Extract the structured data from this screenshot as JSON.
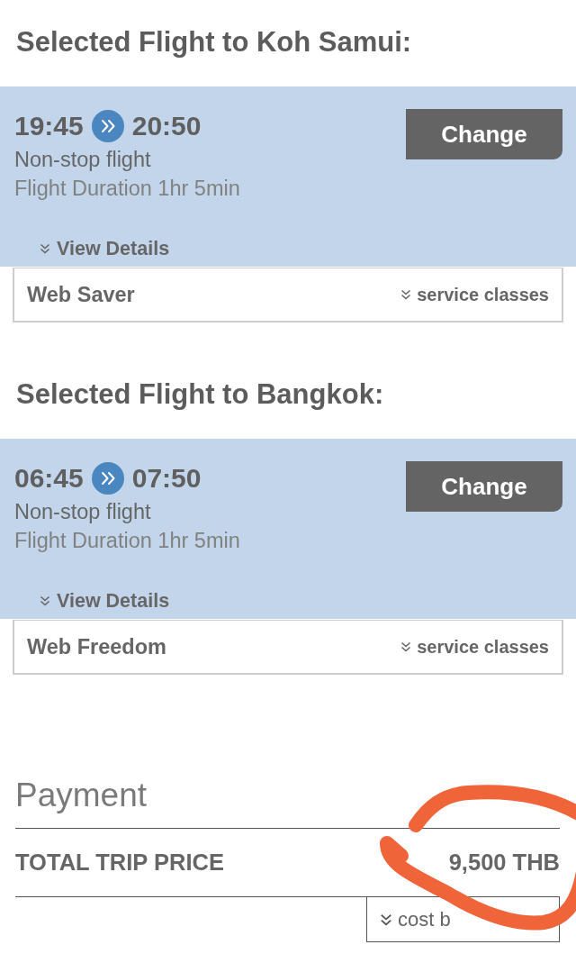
{
  "flights": [
    {
      "heading": "Selected Flight to Koh Samui:",
      "departure": "19:45",
      "arrival": "20:50",
      "stops": "Non-stop flight",
      "duration": "Flight Duration 1hr 5min",
      "change_button": "Change",
      "details_link": "View Details",
      "fare": "Web Saver",
      "service_classes_link": "service classes"
    },
    {
      "heading": "Selected Flight to Bangkok:",
      "departure": "06:45",
      "arrival": "07:50",
      "stops": "Non-stop flight",
      "duration": "Flight Duration 1hr 5min",
      "change_button": "Change",
      "details_link": "View Details",
      "fare": "Web Freedom",
      "service_classes_link": "service classes"
    }
  ],
  "payment": {
    "title": "Payment",
    "total_label": "TOTAL TRIP PRICE",
    "total_value": "9,500 THB",
    "cost_breakdown_button": "cost b"
  }
}
